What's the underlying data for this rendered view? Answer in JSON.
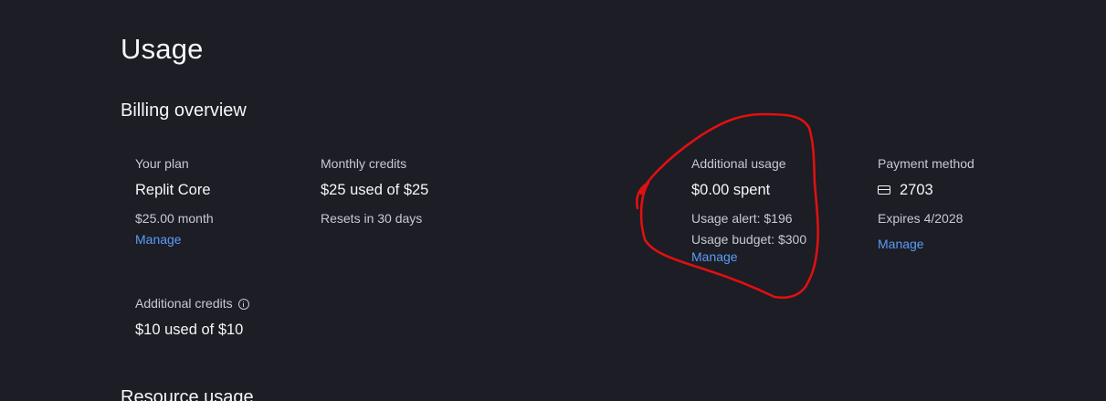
{
  "page": {
    "title": "Usage"
  },
  "billing_overview": {
    "title": "Billing overview",
    "your_plan": {
      "label": "Your plan",
      "value": "Replit Core",
      "price": "$25.00 month",
      "manage_label": "Manage"
    },
    "monthly_credits": {
      "label": "Monthly credits",
      "value": "$25 used of $25",
      "resets": "Resets in 30 days"
    },
    "additional_usage": {
      "label": "Additional usage",
      "value": "$0.00 spent",
      "alert": "Usage alert: $196",
      "budget": "Usage budget: $300",
      "manage_label": "Manage"
    },
    "payment_method": {
      "label": "Payment method",
      "card_icon": "credit-card-icon",
      "value": "2703",
      "expires": "Expires 4/2028",
      "manage_label": "Manage"
    },
    "additional_credits": {
      "label": "Additional credits",
      "info_icon": "info-icon",
      "value": "$10 used of $10"
    }
  },
  "resource_usage": {
    "title": "Resource usage"
  },
  "colors": {
    "background": "#1c1d25",
    "link": "#5c9cf5",
    "annotation": "#e01010"
  }
}
